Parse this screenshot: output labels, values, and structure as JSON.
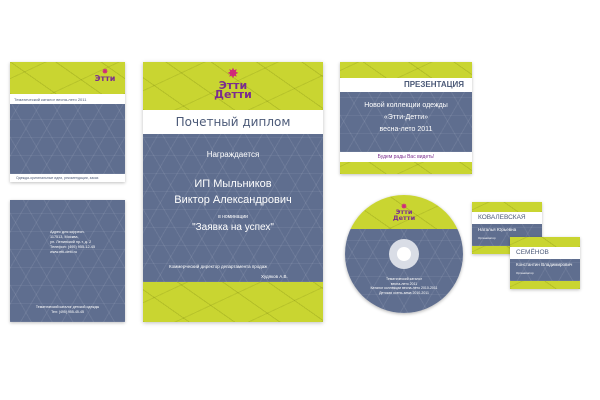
{
  "catalog_cover": {
    "subtitle": "Тематический каталог весна-лето 2011",
    "footer": "Одежда-оригинальные идеи, рекомендации, заказ"
  },
  "catalog_back": {
    "address_lines": [
      "Адрес для корресп.",
      "117513, Москва,",
      "ул. Ленинский пр-т, д. 2",
      "Телефон: (495) 955-12-45",
      "www.etti-detti.ru"
    ],
    "bottom": "Тематический каталог детской одежды",
    "bottom2": "Тел: (495) 955-45-45"
  },
  "diploma": {
    "logo_top": "Этти",
    "logo_bottom": "Детти",
    "title": "Почетный диплом",
    "awarded": "Награждается",
    "name_line1": "ИП Мыльников",
    "name_line2": "Виктор Александрович",
    "nomination_label": "в номинации",
    "nomination": "\"Заявка на успех\"",
    "signature_title": "Коммерческий директор департамента продаж",
    "signature_name": "Худяков А.В."
  },
  "presentation": {
    "header": "ПРЕЗЕНТАЦИЯ",
    "line1": "Новой коллекции одежды",
    "line2": "«Этти-Детти»",
    "line3": "весна-лето 2011",
    "footer": "Будем рады Вас видеть!"
  },
  "cd": {
    "logo_top": "Этти",
    "logo_bottom": "Детти",
    "line1": "Тематический каталог",
    "line2": "весна-лето 2011",
    "line3": "Каталог коллекции весна-лето 2010-2011",
    "line4": "Детская осень-зима 2010-2011"
  },
  "card1": {
    "surname": "КОВАЛЕВСКАЯ",
    "name": "Наталья Юрьевна",
    "role": "Организатор"
  },
  "card2": {
    "surname": "СЕМЁНОВ",
    "name": "Константин Владимирович",
    "role": "Организатор"
  },
  "colors": {
    "slate": "#5f6e8f",
    "lime": "#c9d531",
    "brand_purple": "#7b2d8e",
    "brand_pink": "#d02a7a"
  }
}
